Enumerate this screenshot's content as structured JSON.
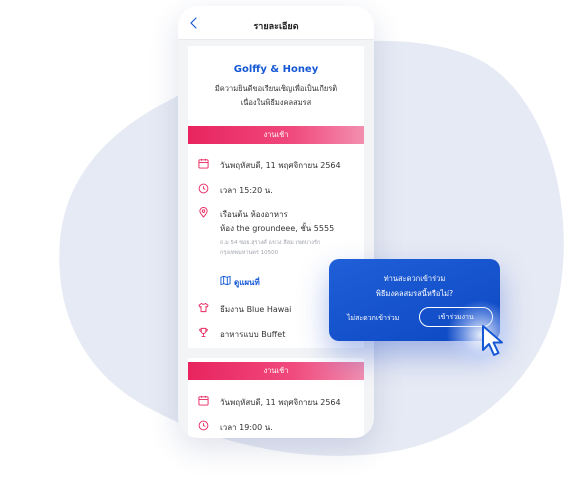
{
  "colors": {
    "accent": "#1458d6",
    "band": "#e8245e",
    "popup": "#0d48c2",
    "blob": "#e6eaf4"
  },
  "header": {
    "title": "รายละเอียด",
    "back_icon": "chevron-left-icon"
  },
  "event": {
    "couple": "Golffy & Honey",
    "invite_line1": "มีความยินดีขอเรียนเชิญเพื่อเป็นเกียรติ",
    "invite_line2": "เนื่องในพิธีมงคลสมรส"
  },
  "section1": {
    "band_label": "งานเช้า",
    "date": "วันพฤหัสบดี, 11 พฤศจิกายน 2564",
    "time": "เวลา 15:20 น.",
    "venue_name": "เรือนต้น ห้องอาหาร",
    "venue_room": "ห้อง the groundeee, ชั้น 5555",
    "address_line1": "ถ.ม 54 ซอย.สุรวงศ์ แขวง สีลม เขตบางรัก",
    "address_line2": "กรุงเทพมหานคร 10500",
    "map_label": "ดูแผนที่",
    "dress": "ธีมงาน Blue Hawai",
    "food": "อาหารแบบ Buffet"
  },
  "section2": {
    "band_label": "งานเช้า",
    "date": "วันพฤหัสบดี, 11 พฤศจิกายน 2564",
    "time": "เวลา 19:00 น."
  },
  "popup": {
    "question_line1": "ท่านสะดวกเข้าร่วม",
    "question_line2": "พิธีมงคลสมรสนี้หรือไม่?",
    "decline_label": "ไม่สะดวกเข้าร่วม",
    "accept_label": "เข้าร่วมงาน"
  }
}
